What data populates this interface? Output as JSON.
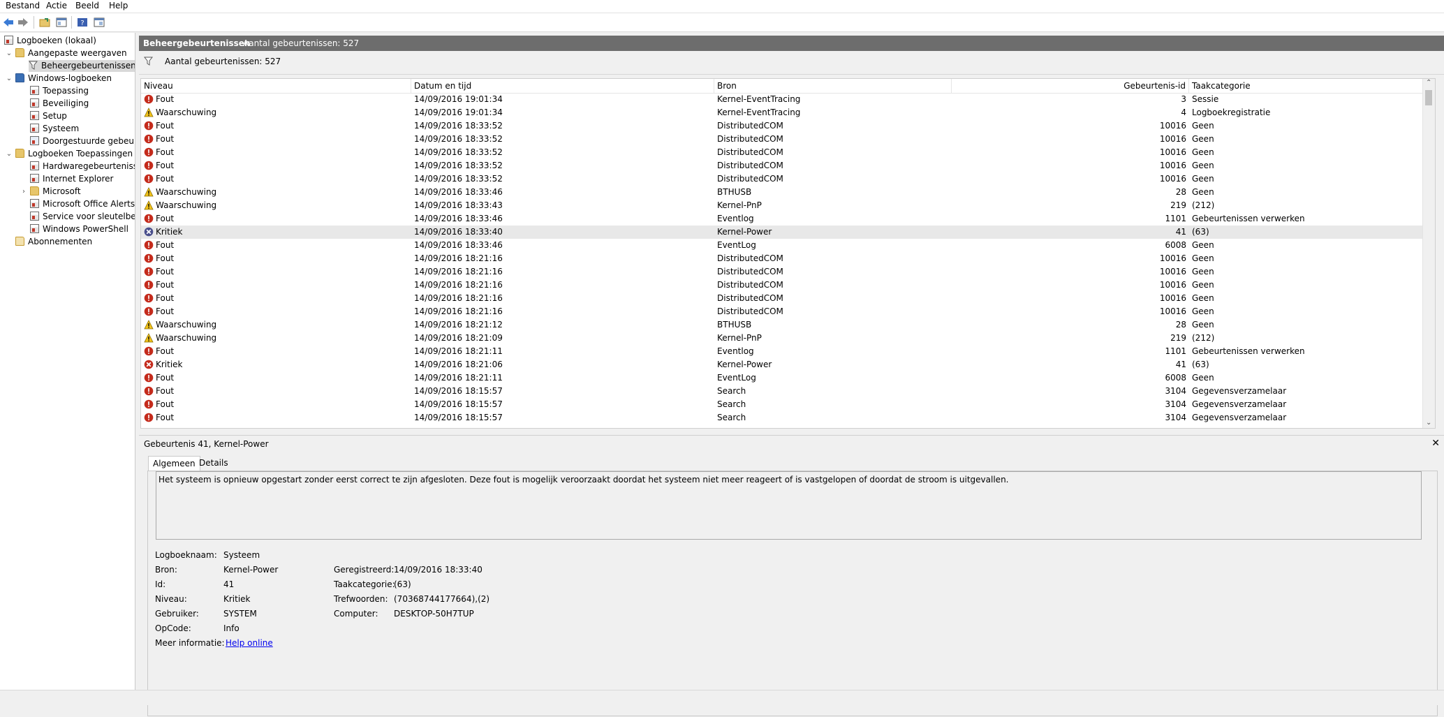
{
  "menu": [
    "Bestand",
    "Actie",
    "Beeld",
    "Help"
  ],
  "toolbar_icons": [
    "back-arrow-icon",
    "forward-arrow-icon",
    "open-folder-icon",
    "properties-icon",
    "help-icon",
    "console-view-icon"
  ],
  "tree": {
    "root": "Logboeken (lokaal)",
    "custom_views": "Aangepaste weergaven",
    "admin_events": "Beheergebeurtenissen",
    "windows_logs": "Windows-logboeken",
    "application": "Toepassing",
    "security": "Beveiliging",
    "setup": "Setup",
    "system": "Systeem",
    "forwarded": "Doorgestuurde gebeurtenissen",
    "apps_services": "Logboeken Toepassingen en services",
    "hardware": "Hardwaregebeurtenissen",
    "ie": "Internet Explorer",
    "microsoft": "Microsoft",
    "office": "Microsoft Office Alerts",
    "key_mgmt": "Service voor sleutelbeheer",
    "powershell": "Windows PowerShell",
    "subscriptions": "Abonnementen"
  },
  "main": {
    "title": "Beheergebeurtenissen",
    "title_count": "Aantal gebeurtenissen: 527",
    "filter_text": "Aantal gebeurtenissen: 527"
  },
  "columns": [
    "Niveau",
    "Datum en tijd",
    "Bron",
    "Gebeurtenis-id",
    "Taakcategorie"
  ],
  "events": [
    {
      "level": "Fout",
      "type": "error",
      "datetime": "14/09/2016 19:01:34",
      "source": "Kernel-EventTracing",
      "id": "3",
      "category": "Sessie"
    },
    {
      "level": "Waarschuwing",
      "type": "warning",
      "datetime": "14/09/2016 19:01:34",
      "source": "Kernel-EventTracing",
      "id": "4",
      "category": "Logboekregistratie"
    },
    {
      "level": "Fout",
      "type": "error",
      "datetime": "14/09/2016 18:33:52",
      "source": "DistributedCOM",
      "id": "10016",
      "category": "Geen"
    },
    {
      "level": "Fout",
      "type": "error",
      "datetime": "14/09/2016 18:33:52",
      "source": "DistributedCOM",
      "id": "10016",
      "category": "Geen"
    },
    {
      "level": "Fout",
      "type": "error",
      "datetime": "14/09/2016 18:33:52",
      "source": "DistributedCOM",
      "id": "10016",
      "category": "Geen"
    },
    {
      "level": "Fout",
      "type": "error",
      "datetime": "14/09/2016 18:33:52",
      "source": "DistributedCOM",
      "id": "10016",
      "category": "Geen"
    },
    {
      "level": "Fout",
      "type": "error",
      "datetime": "14/09/2016 18:33:52",
      "source": "DistributedCOM",
      "id": "10016",
      "category": "Geen"
    },
    {
      "level": "Waarschuwing",
      "type": "warning",
      "datetime": "14/09/2016 18:33:46",
      "source": "BTHUSB",
      "id": "28",
      "category": "Geen"
    },
    {
      "level": "Waarschuwing",
      "type": "warning",
      "datetime": "14/09/2016 18:33:43",
      "source": "Kernel-PnP",
      "id": "219",
      "category": "(212)"
    },
    {
      "level": "Fout",
      "type": "error",
      "datetime": "14/09/2016 18:33:46",
      "source": "Eventlog",
      "id": "1101",
      "category": "Gebeurtenissen verwerken"
    },
    {
      "level": "Kritiek",
      "type": "critical-selected",
      "datetime": "14/09/2016 18:33:40",
      "source": "Kernel-Power",
      "id": "41",
      "category": "(63)"
    },
    {
      "level": "Fout",
      "type": "error",
      "datetime": "14/09/2016 18:33:46",
      "source": "EventLog",
      "id": "6008",
      "category": "Geen"
    },
    {
      "level": "Fout",
      "type": "error",
      "datetime": "14/09/2016 18:21:16",
      "source": "DistributedCOM",
      "id": "10016",
      "category": "Geen"
    },
    {
      "level": "Fout",
      "type": "error",
      "datetime": "14/09/2016 18:21:16",
      "source": "DistributedCOM",
      "id": "10016",
      "category": "Geen"
    },
    {
      "level": "Fout",
      "type": "error",
      "datetime": "14/09/2016 18:21:16",
      "source": "DistributedCOM",
      "id": "10016",
      "category": "Geen"
    },
    {
      "level": "Fout",
      "type": "error",
      "datetime": "14/09/2016 18:21:16",
      "source": "DistributedCOM",
      "id": "10016",
      "category": "Geen"
    },
    {
      "level": "Fout",
      "type": "error",
      "datetime": "14/09/2016 18:21:16",
      "source": "DistributedCOM",
      "id": "10016",
      "category": "Geen"
    },
    {
      "level": "Waarschuwing",
      "type": "warning",
      "datetime": "14/09/2016 18:21:12",
      "source": "BTHUSB",
      "id": "28",
      "category": "Geen"
    },
    {
      "level": "Waarschuwing",
      "type": "warning",
      "datetime": "14/09/2016 18:21:09",
      "source": "Kernel-PnP",
      "id": "219",
      "category": "(212)"
    },
    {
      "level": "Fout",
      "type": "error",
      "datetime": "14/09/2016 18:21:11",
      "source": "Eventlog",
      "id": "1101",
      "category": "Gebeurtenissen verwerken"
    },
    {
      "level": "Kritiek",
      "type": "critical",
      "datetime": "14/09/2016 18:21:06",
      "source": "Kernel-Power",
      "id": "41",
      "category": "(63)"
    },
    {
      "level": "Fout",
      "type": "error",
      "datetime": "14/09/2016 18:21:11",
      "source": "EventLog",
      "id": "6008",
      "category": "Geen"
    },
    {
      "level": "Fout",
      "type": "error",
      "datetime": "14/09/2016 18:15:57",
      "source": "Search",
      "id": "3104",
      "category": "Gegevensverzamelaar"
    },
    {
      "level": "Fout",
      "type": "error",
      "datetime": "14/09/2016 18:15:57",
      "source": "Search",
      "id": "3104",
      "category": "Gegevensverzamelaar"
    },
    {
      "level": "Fout",
      "type": "error",
      "datetime": "14/09/2016 18:15:57",
      "source": "Search",
      "id": "3104",
      "category": "Gegevensverzamelaar"
    }
  ],
  "detail": {
    "title": "Gebeurtenis 41, Kernel-Power",
    "tabs": [
      "Algemeen",
      "Details"
    ],
    "description": "Het systeem is opnieuw opgestart zonder eerst correct te zijn afgesloten. Deze fout is mogelijk veroorzaakt doordat het systeem niet meer reageert of is vastgelopen of doordat de stroom is uitgevallen.",
    "props_left": [
      {
        "label": "Logboeknaam:",
        "value": "Systeem"
      },
      {
        "label": "Bron:",
        "value": "Kernel-Power"
      },
      {
        "label": "Id:",
        "value": "41"
      },
      {
        "label": "Niveau:",
        "value": "Kritiek"
      },
      {
        "label": "Gebruiker:",
        "value": "SYSTEM"
      },
      {
        "label": "OpCode:",
        "value": "Info"
      },
      {
        "label": "Meer informatie:",
        "value": "Help online"
      }
    ],
    "props_right": [
      {
        "label": "Geregistreerd:",
        "value": "14/09/2016 18:33:40"
      },
      {
        "label": "Taakcategorie:",
        "value": "(63)"
      },
      {
        "label": "Trefwoorden:",
        "value": "(70368744177664),(2)"
      },
      {
        "label": "Computer:",
        "value": "DESKTOP-50H7TUP"
      }
    ]
  },
  "colors": {
    "error": "#c42b1c",
    "warning": "#f2c31b",
    "critical": "#c42b1c",
    "critical_selected": "#4a4f8c",
    "title_bar": "#6d6d6d",
    "link": "#0000ee"
  }
}
